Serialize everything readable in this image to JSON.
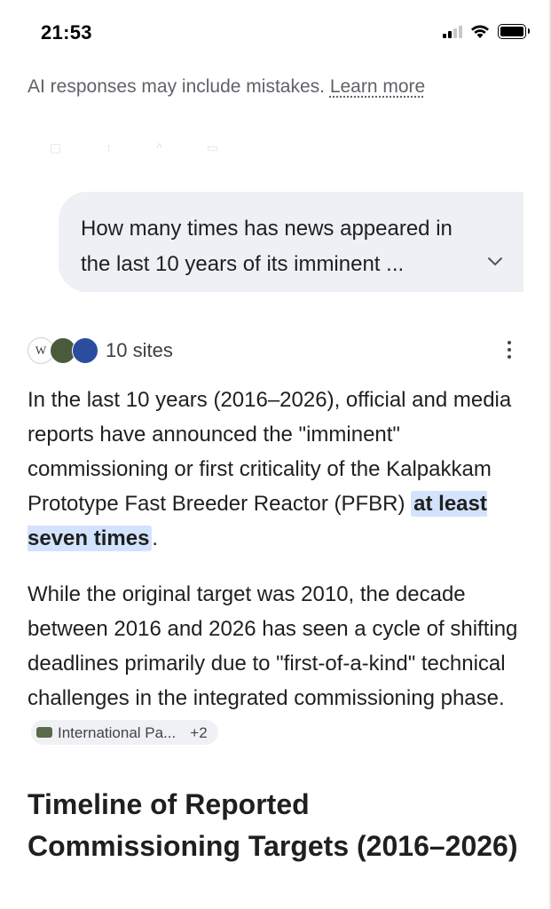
{
  "status_bar": {
    "time": "21:53",
    "icons": [
      "signal-icon",
      "wifi-icon",
      "battery-icon"
    ]
  },
  "disclaimer": {
    "text": "AI responses may include mistakes. ",
    "link": "Learn more"
  },
  "query": {
    "text": "How many times has news appeared in the last 10 years of its imminent ..."
  },
  "sources": {
    "label": "10 sites",
    "favicon_w": "W"
  },
  "answer": {
    "para1_before": "In the last 10 years (2016–2026), official and media reports have announced the \"imminent\" commissioning or first criticality of the Kalpakkam Prototype Fast Breeder Reactor (PFBR) ",
    "para1_highlight": "at least seven times",
    "para1_after": ".",
    "para2": "While the original target was 2010, the decade between 2016 and 2026 has seen a cycle of shifting deadlines primarily due to \"first-of-a-kind\" technical challenges in the integrated commissioning phase. ",
    "chip_label": "International Pa...",
    "chip_more": "+2",
    "heading": "Timeline of Reported Commissioning Targets (2016–2026)"
  },
  "colors": {
    "highlight": "#d3e3fd",
    "bubble": "#eef0f5"
  }
}
